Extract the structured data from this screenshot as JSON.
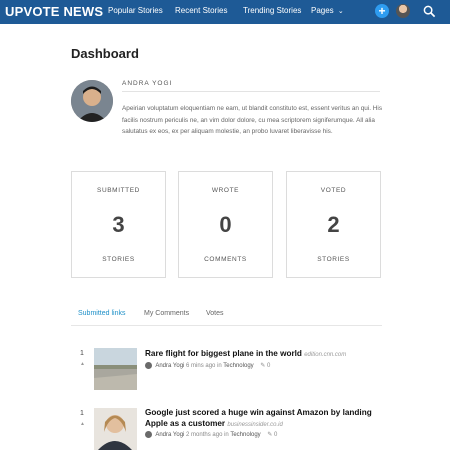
{
  "nav": {
    "logo": "UPVOTE NEWS",
    "links": [
      "Popular Stories",
      "Recent Stories",
      "Trending Stories",
      "Pages"
    ],
    "plus_label": "+",
    "pages_caret": "⌄"
  },
  "page_title": "Dashboard",
  "profile": {
    "name": "ANDRA YOGI",
    "bio": "Apeirian voluptatum eloquentiam ne eam, ut blandit constituto est, essent veritus an qui. His facilis nostrum periculis ne, an vim dolor dolore, cu mea scriptorem signiferumque. All alia salutatus ex eos, ex per aliquam molestie, an probo luvaret liberavisse his."
  },
  "stats": [
    {
      "top": "SUBMITTED",
      "number": "3",
      "bottom": "STORIES"
    },
    {
      "top": "WROTE",
      "number": "0",
      "bottom": "COMMENTS"
    },
    {
      "top": "VOTED",
      "number": "2",
      "bottom": "STORIES"
    }
  ],
  "tabs": [
    "Submitted links",
    "My Comments",
    "Votes"
  ],
  "active_tab": "Submitted links",
  "stories": [
    {
      "rank": "1",
      "title": "Rare flight for biggest plane in the world",
      "source": "edition.cnn.com",
      "author": "Andra Yogi",
      "time": "6 mins ago in",
      "category": "Technology",
      "comments": "0"
    },
    {
      "rank": "1",
      "title": "Google just scored a huge win against Amazon by landing Apple as a customer",
      "source": "businessinsider.co.id",
      "author": "Andra Yogi",
      "time": "2 months ago in",
      "category": "Technology",
      "comments": "0"
    }
  ],
  "colors": {
    "nav": "#1e5a96",
    "accent": "#2e9cf0",
    "tab_active": "#1e90c8"
  },
  "icons": [
    "plus-icon",
    "user-avatar",
    "search-icon",
    "upvote-arrow-icon",
    "comment-icon"
  ]
}
